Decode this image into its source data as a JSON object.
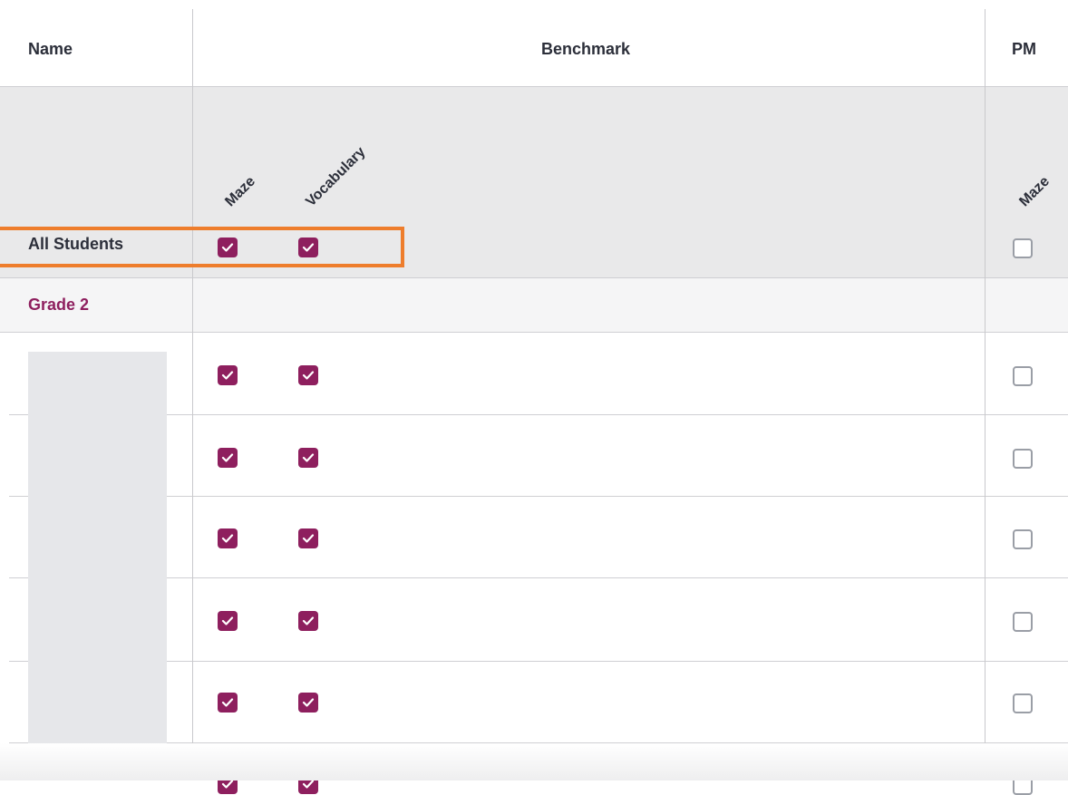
{
  "header": {
    "name_label": "Name",
    "benchmark_label": "Benchmark",
    "pm_label": "PM"
  },
  "columns": {
    "benchmark": [
      "Maze",
      "Vocabulary"
    ],
    "pm": [
      "Maze"
    ]
  },
  "all_students": {
    "label": "All Students",
    "benchmark_checked": [
      true,
      true
    ],
    "pm_checked": [
      false
    ]
  },
  "group": {
    "label": "Grade 2",
    "color": "#8e1f5e"
  },
  "students": [
    {
      "benchmark_checked": [
        true,
        true
      ],
      "pm_checked": [
        false
      ]
    },
    {
      "benchmark_checked": [
        true,
        true
      ],
      "pm_checked": [
        false
      ]
    },
    {
      "benchmark_checked": [
        true,
        true
      ],
      "pm_checked": [
        false
      ]
    },
    {
      "benchmark_checked": [
        true,
        true
      ],
      "pm_checked": [
        false
      ]
    },
    {
      "benchmark_checked": [
        true,
        true
      ],
      "pm_checked": [
        false
      ]
    },
    {
      "benchmark_checked": [
        true,
        true
      ],
      "pm_checked": [
        false
      ]
    }
  ],
  "colors": {
    "checkbox_checked": "#8e1f5e",
    "highlight": "#ee7d2c",
    "header_band": "#e9e9ea",
    "group_band": "#f5f5f6"
  }
}
